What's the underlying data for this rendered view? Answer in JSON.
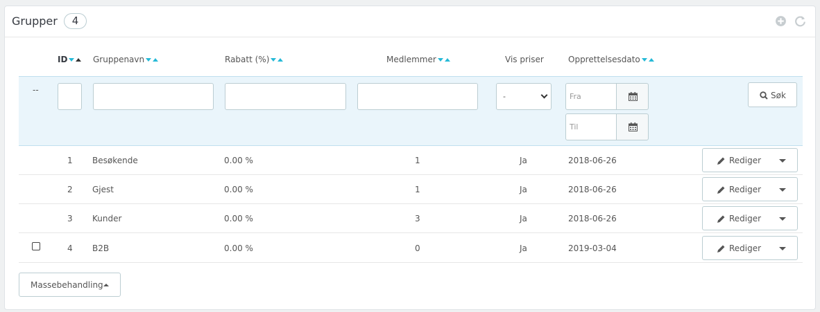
{
  "header": {
    "title": "Grupper",
    "count": "4"
  },
  "toolbar": {
    "add_icon": "plus-circle-icon",
    "refresh_icon": "refresh-icon"
  },
  "columns": {
    "id": "ID",
    "name": "Gruppenavn",
    "discount": "Rabatt (%)",
    "members": "Medlemmer",
    "show_prices": "Vis priser",
    "created": "Opprettelsesdato"
  },
  "filter": {
    "dash": "--",
    "show_prices_selected": "-",
    "date_from_placeholder": "Fra",
    "date_to_placeholder": "Til",
    "search_label": "Søk"
  },
  "rows": [
    {
      "id": "1",
      "name": "Besøkende",
      "discount": "0.00 %",
      "members": "1",
      "show_prices": "Ja",
      "created": "2018-06-26",
      "edit": "Rediger"
    },
    {
      "id": "2",
      "name": "Gjest",
      "discount": "0.00 %",
      "members": "1",
      "show_prices": "Ja",
      "created": "2018-06-26",
      "edit": "Rediger"
    },
    {
      "id": "3",
      "name": "Kunder",
      "discount": "0.00 %",
      "members": "3",
      "show_prices": "Ja",
      "created": "2018-06-26",
      "edit": "Rediger"
    },
    {
      "id": "4",
      "name": "B2B",
      "discount": "0.00 %",
      "members": "0",
      "show_prices": "Ja",
      "created": "2019-03-04",
      "edit": "Rediger"
    }
  ],
  "bulk_label": "Massebehandling"
}
